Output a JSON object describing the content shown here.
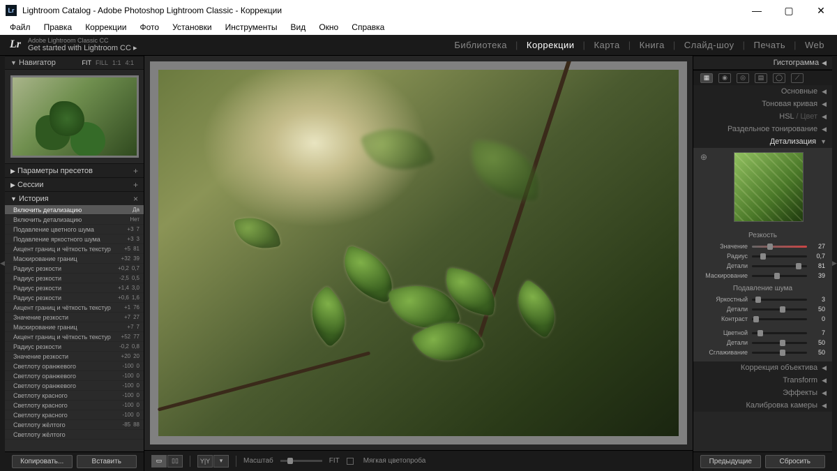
{
  "window": {
    "title": "Lightroom Catalog - Adobe Photoshop Lightroom Classic - Коррекции"
  },
  "menu": [
    "Файл",
    "Правка",
    "Коррекции",
    "Фото",
    "Установки",
    "Инструменты",
    "Вид",
    "Окно",
    "Справка"
  ],
  "identity": {
    "logo": "Lr",
    "line1": "Adobe Lightroom Classic CC",
    "line2": "Get started with Lightroom CC ▸"
  },
  "modules": [
    {
      "label": "Библиотека",
      "active": false
    },
    {
      "label": "Коррекции",
      "active": true
    },
    {
      "label": "Карта",
      "active": false
    },
    {
      "label": "Книга",
      "active": false
    },
    {
      "label": "Слайд-шоу",
      "active": false
    },
    {
      "label": "Печать",
      "active": false
    },
    {
      "label": "Web",
      "active": false
    }
  ],
  "left": {
    "navigator": "Навигатор",
    "fitOptions": [
      "FIT",
      "FILL",
      "1:1",
      "4:1"
    ],
    "presetPanel": "Параметры пресетов",
    "snapshots": "Сессии",
    "historyLabel": "История",
    "history": [
      {
        "t": "Включить детализацию",
        "a": "",
        "b": "Да",
        "sel": true
      },
      {
        "t": "Включить детализацию",
        "a": "",
        "b": "Нет"
      },
      {
        "t": "Подавление цветного шума",
        "a": "+3",
        "b": "7"
      },
      {
        "t": "Подавление яркостного шума",
        "a": "+3",
        "b": "3"
      },
      {
        "t": "Акцент границ и чёткость текстур",
        "a": "+5",
        "b": "81"
      },
      {
        "t": "Маскирование границ",
        "a": "+32",
        "b": "39"
      },
      {
        "t": "Радиус резкости",
        "a": "+0,2",
        "b": "0,7"
      },
      {
        "t": "Радиус резкости",
        "a": "-2,5",
        "b": "0,5"
      },
      {
        "t": "Радиус резкости",
        "a": "+1,4",
        "b": "3,0"
      },
      {
        "t": "Радиус резкости",
        "a": "+0,6",
        "b": "1,6"
      },
      {
        "t": "Акцент границ и чёткость текстур",
        "a": "+1",
        "b": "76"
      },
      {
        "t": "Значение резкости",
        "a": "+7",
        "b": "27"
      },
      {
        "t": "Маскирование границ",
        "a": "+7",
        "b": "7"
      },
      {
        "t": "Акцент границ и чёткость текстур",
        "a": "+52",
        "b": "77"
      },
      {
        "t": "Радиус резкости",
        "a": "-0,2",
        "b": "0,8"
      },
      {
        "t": "Значение резкости",
        "a": "+20",
        "b": "20"
      },
      {
        "t": "Светлоту оранжевого",
        "a": "-100",
        "b": "0"
      },
      {
        "t": "Светлоту оранжевого",
        "a": "-100",
        "b": "0"
      },
      {
        "t": "Светлоту оранжевого",
        "a": "-100",
        "b": "0"
      },
      {
        "t": "Светлоту красного",
        "a": "-100",
        "b": "0"
      },
      {
        "t": "Светлоту красного",
        "a": "-100",
        "b": "0"
      },
      {
        "t": "Светлоту красного",
        "a": "-100",
        "b": "0"
      },
      {
        "t": "Светлоту жёлтого",
        "a": "-85",
        "b": "88"
      },
      {
        "t": "Светлоту жёлтого",
        "a": "",
        "b": ""
      }
    ],
    "copyBtn": "Копировать...",
    "pasteBtn": "Вставить"
  },
  "toolbar": {
    "zoomLabel": "Масштаб",
    "fit": "FIT",
    "softproof": "Мягкая цветопроба"
  },
  "right": {
    "histogram": "Гистограмма",
    "basic": "Основные",
    "tone": "Тоновая кривая",
    "hslLabel": "HSL",
    "hslDim": "/ Цвет",
    "split": "Раздельное тонирование",
    "detail": "Детализация",
    "sharpHead": "Резкость",
    "noiseHead": "Подавление шума",
    "sharp": [
      {
        "label": "Значение",
        "val": "27",
        "pos": 28
      },
      {
        "label": "Радиус",
        "val": "0,7",
        "pos": 15
      },
      {
        "label": "Детали",
        "val": "81",
        "pos": 80
      },
      {
        "label": "Маскирование",
        "val": "39",
        "pos": 40
      }
    ],
    "lum": [
      {
        "label": "Яркостный",
        "val": "3",
        "pos": 6
      },
      {
        "label": "Детали",
        "val": "50",
        "pos": 50
      },
      {
        "label": "Контраст",
        "val": "0",
        "pos": 3
      }
    ],
    "col": [
      {
        "label": "Цветной",
        "val": "7",
        "pos": 10
      },
      {
        "label": "Детали",
        "val": "50",
        "pos": 50
      },
      {
        "label": "Сглаживание",
        "val": "50",
        "pos": 50
      }
    ],
    "lens": "Коррекция объектива",
    "transform": "Transform",
    "effects": "Эффекты",
    "calib": "Калибровка камеры",
    "prevBtn": "Предыдущие",
    "resetBtn": "Сбросить"
  }
}
